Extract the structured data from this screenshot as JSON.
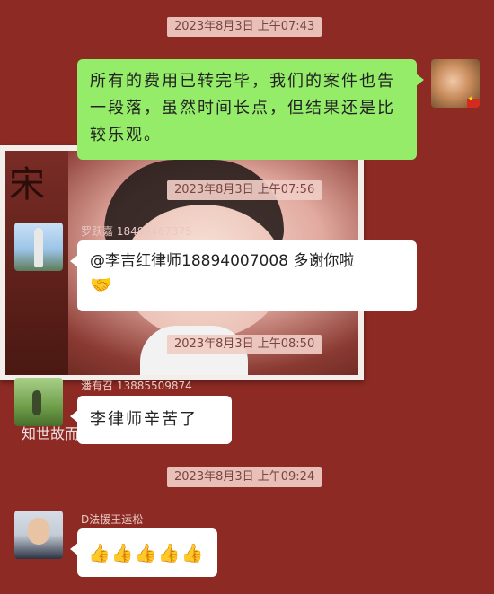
{
  "messages": [
    {
      "timestamp": "2023年8月3日 上午07:43",
      "sender": "",
      "side": "right",
      "text": "所有的费用已转完毕，我们的案件也告一段落，虽然时间长点，但结果还是比较乐观。"
    },
    {
      "timestamp": "2023年8月3日 上午07:56",
      "sender": "罗跃嘉 18485467375",
      "side": "left",
      "text": "@李吉红律师18894007008 多谢你啦",
      "emoji": "🤝"
    },
    {
      "timestamp": "2023年8月3日 上午08:50",
      "sender": "潘有召 13885509874",
      "side": "left",
      "text": "李律师辛苦了"
    },
    {
      "timestamp": "2023年8月3日 上午09:24",
      "sender": "D法援王运松",
      "side": "left",
      "emoji": "👍👍👍👍👍"
    }
  ],
  "background_overlay": {
    "photo_sign": "宋",
    "caption": "知世故而不世故 真人"
  },
  "colors": {
    "background": "#8e2a24",
    "sent_bubble": "#95ec69",
    "received_bubble": "#ffffff",
    "timestamp_pill": "#f0cdc6"
  }
}
